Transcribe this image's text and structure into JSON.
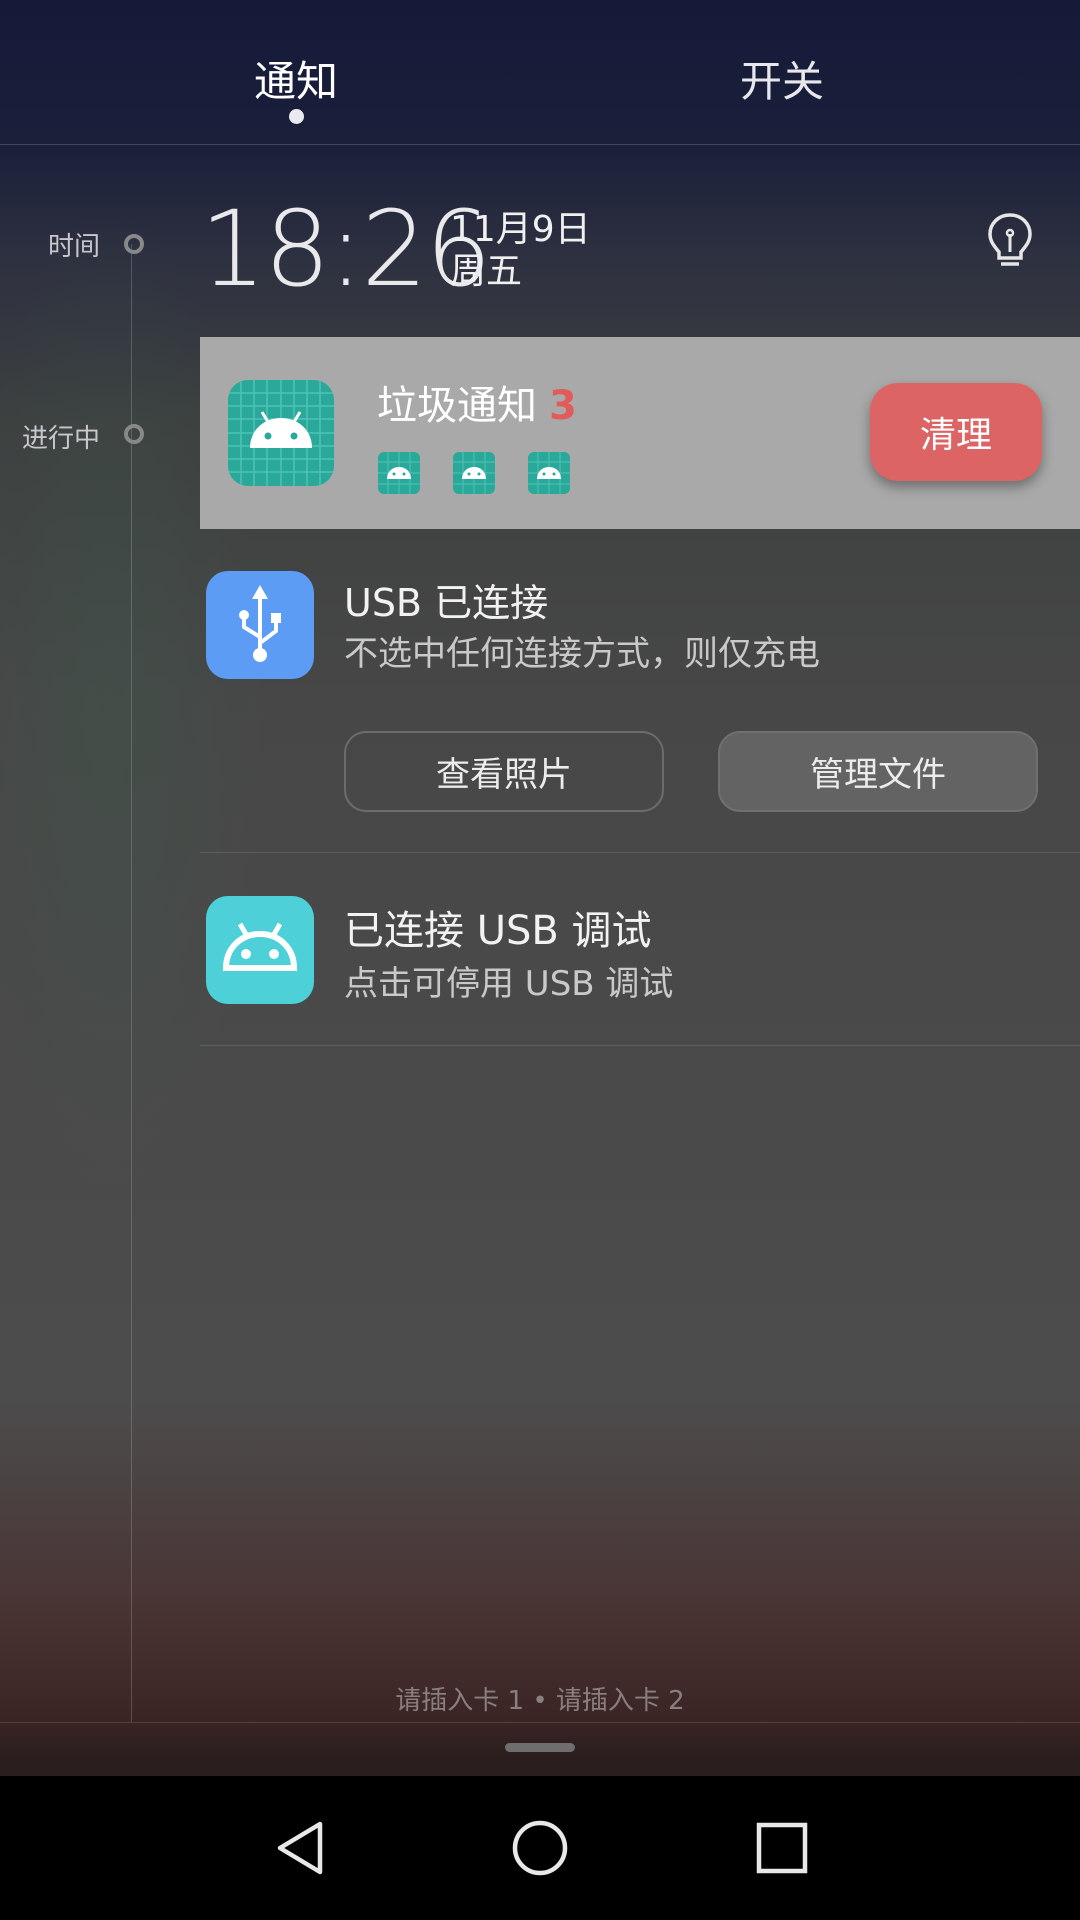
{
  "tabs": {
    "notify": "通知",
    "switches": "开关"
  },
  "timeline": {
    "time_label": "时间",
    "ongoing_label": "进行中"
  },
  "clock": {
    "time": "18:26",
    "date": "11月9日",
    "weekday": "周五"
  },
  "junk_notification": {
    "title": "垃圾通知",
    "count": "3",
    "clean_label": "清理"
  },
  "usb_notification": {
    "title": "USB 已连接",
    "subtitle": "不选中任何连接方式，则仅充电",
    "view_photos_label": "查看照片",
    "manage_files_label": "管理文件"
  },
  "usb_debug_notification": {
    "title": "已连接 USB 调试",
    "subtitle": "点击可停用 USB 调试"
  },
  "status": {
    "sim": "请插入卡 1 • 请插入卡 2"
  },
  "colors": {
    "accent_red": "#dd6464",
    "usb_blue": "#5c9cf4",
    "debug_teal": "#4dd0d8",
    "junk_icon_teal": "#2aa89a"
  },
  "icons": {
    "bulb": "lightbulb-icon",
    "usb": "usb-icon",
    "android": "android-icon",
    "back": "back-triangle-icon",
    "home": "home-circle-icon",
    "recent": "recent-square-icon"
  }
}
